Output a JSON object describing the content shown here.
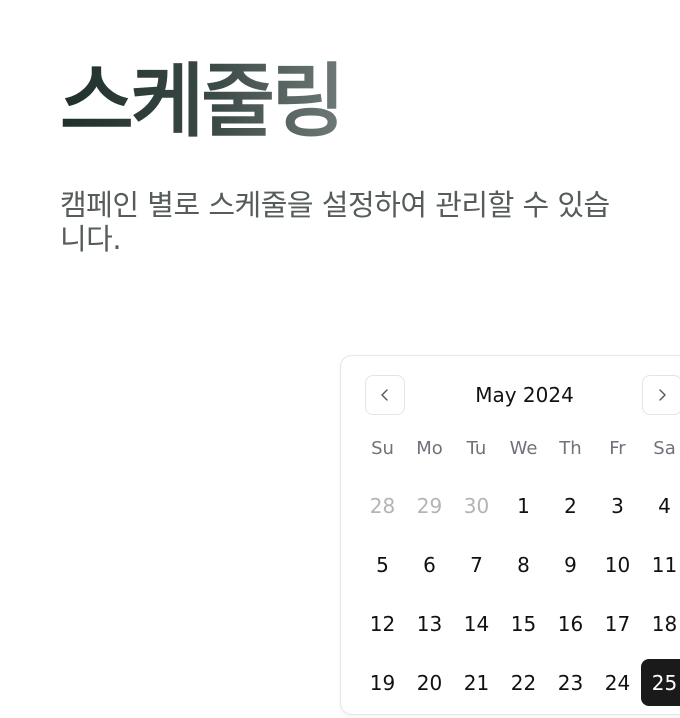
{
  "hero": {
    "title": "스케줄링",
    "description": "캠페인 별로 스케줄을 설정하여 관리할 수 있습니다."
  },
  "calendar": {
    "month_label": "May 2024",
    "prev_icon": "chevron-left-icon",
    "next_icon": "chevron-right-icon",
    "weekdays": [
      "Su",
      "Mo",
      "Tu",
      "We",
      "Th",
      "Fr",
      "Sa"
    ],
    "weeks": [
      [
        {
          "day": "28",
          "outside": true
        },
        {
          "day": "29",
          "outside": true
        },
        {
          "day": "30",
          "outside": true
        },
        {
          "day": "1"
        },
        {
          "day": "2"
        },
        {
          "day": "3"
        },
        {
          "day": "4"
        }
      ],
      [
        {
          "day": "5"
        },
        {
          "day": "6"
        },
        {
          "day": "7"
        },
        {
          "day": "8"
        },
        {
          "day": "9"
        },
        {
          "day": "10"
        },
        {
          "day": "11"
        }
      ],
      [
        {
          "day": "12"
        },
        {
          "day": "13"
        },
        {
          "day": "14"
        },
        {
          "day": "15"
        },
        {
          "day": "16"
        },
        {
          "day": "17"
        },
        {
          "day": "18"
        }
      ],
      [
        {
          "day": "19"
        },
        {
          "day": "20"
        },
        {
          "day": "21"
        },
        {
          "day": "22"
        },
        {
          "day": "23"
        },
        {
          "day": "24"
        },
        {
          "day": "25",
          "selected": true
        }
      ]
    ],
    "colors": {
      "selected_bg": "#1a1a1a",
      "outside_text": "#b4b4b8",
      "weekday_text": "#71717a"
    }
  }
}
